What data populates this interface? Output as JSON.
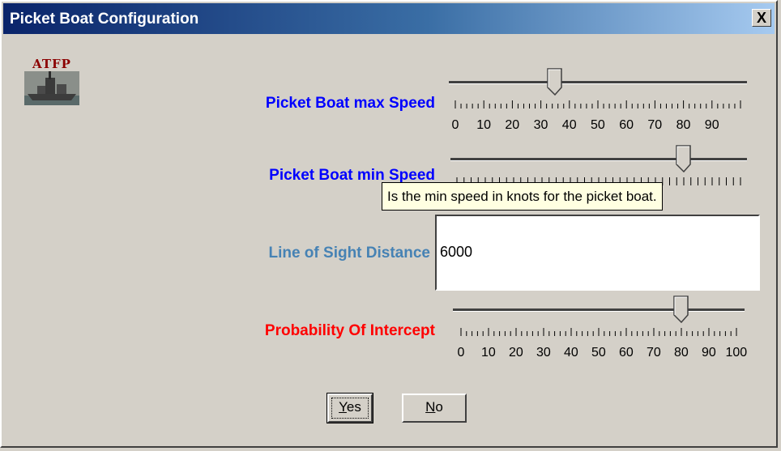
{
  "window": {
    "title": "Picket Boat Configuration",
    "close_label": "X"
  },
  "logo": {
    "text": "ATFP",
    "icon": "warship-image"
  },
  "sliders": [
    {
      "label": "Picket Boat max Speed",
      "label_color": "#0000ff",
      "value": 35,
      "min": 0,
      "max": 100,
      "tick_labels": [
        "0",
        "10",
        "20",
        "30",
        "40",
        "50",
        "60",
        "70",
        "80",
        "90"
      ]
    },
    {
      "label": "Picket Boat min Speed",
      "label_color": "#0000ff",
      "value": 80,
      "min": 0,
      "max": 100,
      "tick_labels": []
    },
    {
      "label": "Probability Of Intercept",
      "label_color": "#ff0000",
      "value": 80,
      "min": 0,
      "max": 100,
      "tick_labels": [
        "0",
        "10",
        "20",
        "30",
        "40",
        "50",
        "60",
        "70",
        "80",
        "90",
        "100"
      ]
    }
  ],
  "tooltip": {
    "text": "Is the min speed in knots for the picket boat."
  },
  "line_of_sight": {
    "label": "Line of Sight Distance",
    "label_color": "#4682b4",
    "value": "6000"
  },
  "buttons": {
    "yes": "Yes",
    "no": "No"
  }
}
